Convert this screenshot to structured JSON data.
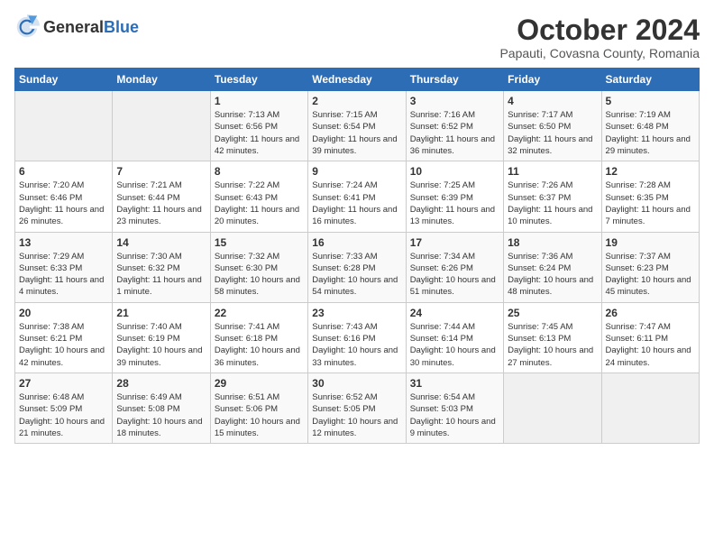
{
  "header": {
    "logo_general": "General",
    "logo_blue": "Blue",
    "month_title": "October 2024",
    "location": "Papauti, Covasna County, Romania"
  },
  "days_of_week": [
    "Sunday",
    "Monday",
    "Tuesday",
    "Wednesday",
    "Thursday",
    "Friday",
    "Saturday"
  ],
  "weeks": [
    [
      {
        "day": "",
        "info": ""
      },
      {
        "day": "",
        "info": ""
      },
      {
        "day": "1",
        "info": "Sunrise: 7:13 AM\nSunset: 6:56 PM\nDaylight: 11 hours and 42 minutes."
      },
      {
        "day": "2",
        "info": "Sunrise: 7:15 AM\nSunset: 6:54 PM\nDaylight: 11 hours and 39 minutes."
      },
      {
        "day": "3",
        "info": "Sunrise: 7:16 AM\nSunset: 6:52 PM\nDaylight: 11 hours and 36 minutes."
      },
      {
        "day": "4",
        "info": "Sunrise: 7:17 AM\nSunset: 6:50 PM\nDaylight: 11 hours and 32 minutes."
      },
      {
        "day": "5",
        "info": "Sunrise: 7:19 AM\nSunset: 6:48 PM\nDaylight: 11 hours and 29 minutes."
      }
    ],
    [
      {
        "day": "6",
        "info": "Sunrise: 7:20 AM\nSunset: 6:46 PM\nDaylight: 11 hours and 26 minutes."
      },
      {
        "day": "7",
        "info": "Sunrise: 7:21 AM\nSunset: 6:44 PM\nDaylight: 11 hours and 23 minutes."
      },
      {
        "day": "8",
        "info": "Sunrise: 7:22 AM\nSunset: 6:43 PM\nDaylight: 11 hours and 20 minutes."
      },
      {
        "day": "9",
        "info": "Sunrise: 7:24 AM\nSunset: 6:41 PM\nDaylight: 11 hours and 16 minutes."
      },
      {
        "day": "10",
        "info": "Sunrise: 7:25 AM\nSunset: 6:39 PM\nDaylight: 11 hours and 13 minutes."
      },
      {
        "day": "11",
        "info": "Sunrise: 7:26 AM\nSunset: 6:37 PM\nDaylight: 11 hours and 10 minutes."
      },
      {
        "day": "12",
        "info": "Sunrise: 7:28 AM\nSunset: 6:35 PM\nDaylight: 11 hours and 7 minutes."
      }
    ],
    [
      {
        "day": "13",
        "info": "Sunrise: 7:29 AM\nSunset: 6:33 PM\nDaylight: 11 hours and 4 minutes."
      },
      {
        "day": "14",
        "info": "Sunrise: 7:30 AM\nSunset: 6:32 PM\nDaylight: 11 hours and 1 minute."
      },
      {
        "day": "15",
        "info": "Sunrise: 7:32 AM\nSunset: 6:30 PM\nDaylight: 10 hours and 58 minutes."
      },
      {
        "day": "16",
        "info": "Sunrise: 7:33 AM\nSunset: 6:28 PM\nDaylight: 10 hours and 54 minutes."
      },
      {
        "day": "17",
        "info": "Sunrise: 7:34 AM\nSunset: 6:26 PM\nDaylight: 10 hours and 51 minutes."
      },
      {
        "day": "18",
        "info": "Sunrise: 7:36 AM\nSunset: 6:24 PM\nDaylight: 10 hours and 48 minutes."
      },
      {
        "day": "19",
        "info": "Sunrise: 7:37 AM\nSunset: 6:23 PM\nDaylight: 10 hours and 45 minutes."
      }
    ],
    [
      {
        "day": "20",
        "info": "Sunrise: 7:38 AM\nSunset: 6:21 PM\nDaylight: 10 hours and 42 minutes."
      },
      {
        "day": "21",
        "info": "Sunrise: 7:40 AM\nSunset: 6:19 PM\nDaylight: 10 hours and 39 minutes."
      },
      {
        "day": "22",
        "info": "Sunrise: 7:41 AM\nSunset: 6:18 PM\nDaylight: 10 hours and 36 minutes."
      },
      {
        "day": "23",
        "info": "Sunrise: 7:43 AM\nSunset: 6:16 PM\nDaylight: 10 hours and 33 minutes."
      },
      {
        "day": "24",
        "info": "Sunrise: 7:44 AM\nSunset: 6:14 PM\nDaylight: 10 hours and 30 minutes."
      },
      {
        "day": "25",
        "info": "Sunrise: 7:45 AM\nSunset: 6:13 PM\nDaylight: 10 hours and 27 minutes."
      },
      {
        "day": "26",
        "info": "Sunrise: 7:47 AM\nSunset: 6:11 PM\nDaylight: 10 hours and 24 minutes."
      }
    ],
    [
      {
        "day": "27",
        "info": "Sunrise: 6:48 AM\nSunset: 5:09 PM\nDaylight: 10 hours and 21 minutes."
      },
      {
        "day": "28",
        "info": "Sunrise: 6:49 AM\nSunset: 5:08 PM\nDaylight: 10 hours and 18 minutes."
      },
      {
        "day": "29",
        "info": "Sunrise: 6:51 AM\nSunset: 5:06 PM\nDaylight: 10 hours and 15 minutes."
      },
      {
        "day": "30",
        "info": "Sunrise: 6:52 AM\nSunset: 5:05 PM\nDaylight: 10 hours and 12 minutes."
      },
      {
        "day": "31",
        "info": "Sunrise: 6:54 AM\nSunset: 5:03 PM\nDaylight: 10 hours and 9 minutes."
      },
      {
        "day": "",
        "info": ""
      },
      {
        "day": "",
        "info": ""
      }
    ]
  ]
}
